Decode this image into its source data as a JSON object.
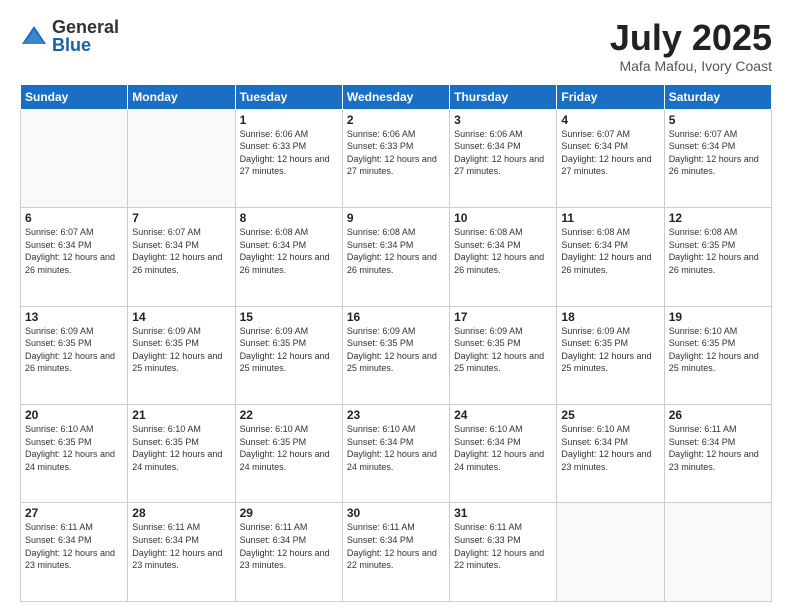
{
  "header": {
    "logo_general": "General",
    "logo_blue": "Blue",
    "month_title": "July 2025",
    "location": "Mafa Mafou, Ivory Coast"
  },
  "weekdays": [
    "Sunday",
    "Monday",
    "Tuesday",
    "Wednesday",
    "Thursday",
    "Friday",
    "Saturday"
  ],
  "weeks": [
    [
      {
        "day": "",
        "info": ""
      },
      {
        "day": "",
        "info": ""
      },
      {
        "day": "1",
        "info": "Sunrise: 6:06 AM\nSunset: 6:33 PM\nDaylight: 12 hours and 27 minutes."
      },
      {
        "day": "2",
        "info": "Sunrise: 6:06 AM\nSunset: 6:33 PM\nDaylight: 12 hours and 27 minutes."
      },
      {
        "day": "3",
        "info": "Sunrise: 6:06 AM\nSunset: 6:34 PM\nDaylight: 12 hours and 27 minutes."
      },
      {
        "day": "4",
        "info": "Sunrise: 6:07 AM\nSunset: 6:34 PM\nDaylight: 12 hours and 27 minutes."
      },
      {
        "day": "5",
        "info": "Sunrise: 6:07 AM\nSunset: 6:34 PM\nDaylight: 12 hours and 26 minutes."
      }
    ],
    [
      {
        "day": "6",
        "info": "Sunrise: 6:07 AM\nSunset: 6:34 PM\nDaylight: 12 hours and 26 minutes."
      },
      {
        "day": "7",
        "info": "Sunrise: 6:07 AM\nSunset: 6:34 PM\nDaylight: 12 hours and 26 minutes."
      },
      {
        "day": "8",
        "info": "Sunrise: 6:08 AM\nSunset: 6:34 PM\nDaylight: 12 hours and 26 minutes."
      },
      {
        "day": "9",
        "info": "Sunrise: 6:08 AM\nSunset: 6:34 PM\nDaylight: 12 hours and 26 minutes."
      },
      {
        "day": "10",
        "info": "Sunrise: 6:08 AM\nSunset: 6:34 PM\nDaylight: 12 hours and 26 minutes."
      },
      {
        "day": "11",
        "info": "Sunrise: 6:08 AM\nSunset: 6:34 PM\nDaylight: 12 hours and 26 minutes."
      },
      {
        "day": "12",
        "info": "Sunrise: 6:08 AM\nSunset: 6:35 PM\nDaylight: 12 hours and 26 minutes."
      }
    ],
    [
      {
        "day": "13",
        "info": "Sunrise: 6:09 AM\nSunset: 6:35 PM\nDaylight: 12 hours and 26 minutes."
      },
      {
        "day": "14",
        "info": "Sunrise: 6:09 AM\nSunset: 6:35 PM\nDaylight: 12 hours and 25 minutes."
      },
      {
        "day": "15",
        "info": "Sunrise: 6:09 AM\nSunset: 6:35 PM\nDaylight: 12 hours and 25 minutes."
      },
      {
        "day": "16",
        "info": "Sunrise: 6:09 AM\nSunset: 6:35 PM\nDaylight: 12 hours and 25 minutes."
      },
      {
        "day": "17",
        "info": "Sunrise: 6:09 AM\nSunset: 6:35 PM\nDaylight: 12 hours and 25 minutes."
      },
      {
        "day": "18",
        "info": "Sunrise: 6:09 AM\nSunset: 6:35 PM\nDaylight: 12 hours and 25 minutes."
      },
      {
        "day": "19",
        "info": "Sunrise: 6:10 AM\nSunset: 6:35 PM\nDaylight: 12 hours and 25 minutes."
      }
    ],
    [
      {
        "day": "20",
        "info": "Sunrise: 6:10 AM\nSunset: 6:35 PM\nDaylight: 12 hours and 24 minutes."
      },
      {
        "day": "21",
        "info": "Sunrise: 6:10 AM\nSunset: 6:35 PM\nDaylight: 12 hours and 24 minutes."
      },
      {
        "day": "22",
        "info": "Sunrise: 6:10 AM\nSunset: 6:35 PM\nDaylight: 12 hours and 24 minutes."
      },
      {
        "day": "23",
        "info": "Sunrise: 6:10 AM\nSunset: 6:34 PM\nDaylight: 12 hours and 24 minutes."
      },
      {
        "day": "24",
        "info": "Sunrise: 6:10 AM\nSunset: 6:34 PM\nDaylight: 12 hours and 24 minutes."
      },
      {
        "day": "25",
        "info": "Sunrise: 6:10 AM\nSunset: 6:34 PM\nDaylight: 12 hours and 23 minutes."
      },
      {
        "day": "26",
        "info": "Sunrise: 6:11 AM\nSunset: 6:34 PM\nDaylight: 12 hours and 23 minutes."
      }
    ],
    [
      {
        "day": "27",
        "info": "Sunrise: 6:11 AM\nSunset: 6:34 PM\nDaylight: 12 hours and 23 minutes."
      },
      {
        "day": "28",
        "info": "Sunrise: 6:11 AM\nSunset: 6:34 PM\nDaylight: 12 hours and 23 minutes."
      },
      {
        "day": "29",
        "info": "Sunrise: 6:11 AM\nSunset: 6:34 PM\nDaylight: 12 hours and 23 minutes."
      },
      {
        "day": "30",
        "info": "Sunrise: 6:11 AM\nSunset: 6:34 PM\nDaylight: 12 hours and 22 minutes."
      },
      {
        "day": "31",
        "info": "Sunrise: 6:11 AM\nSunset: 6:33 PM\nDaylight: 12 hours and 22 minutes."
      },
      {
        "day": "",
        "info": ""
      },
      {
        "day": "",
        "info": ""
      }
    ]
  ]
}
